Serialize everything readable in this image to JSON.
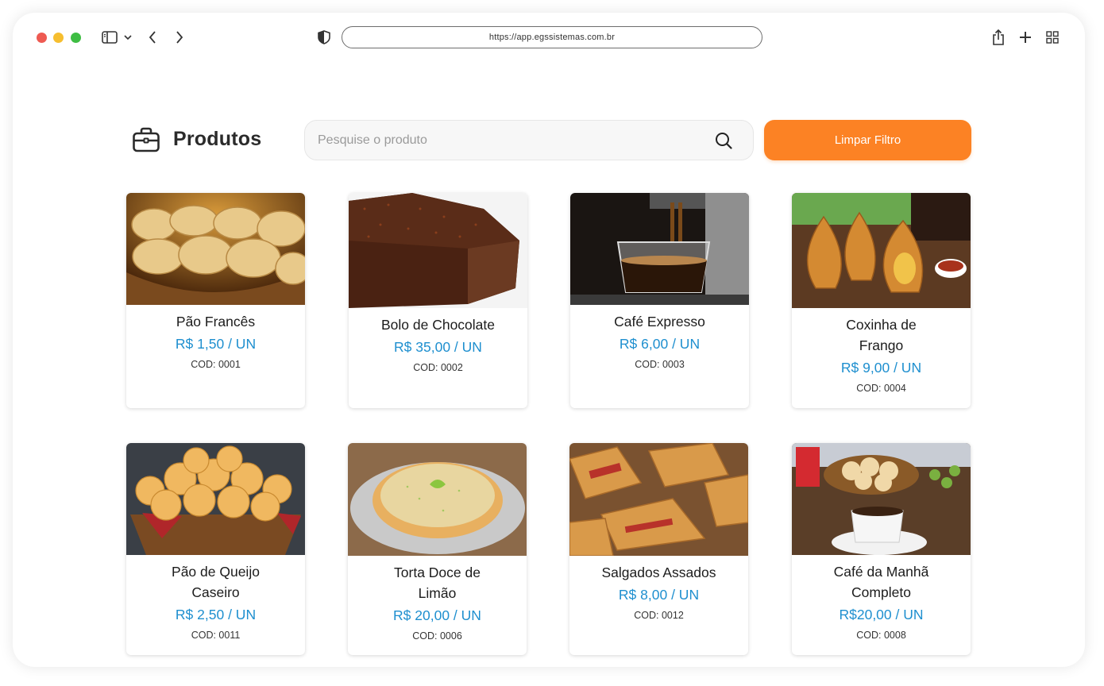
{
  "browser": {
    "url": "https://app.egssistemas.com.br",
    "icons": [
      "sidebar-icon",
      "chevron-down-icon",
      "back-icon",
      "forward-icon",
      "shield-icon",
      "share-icon",
      "plus-icon",
      "tabs-grid-icon"
    ]
  },
  "header": {
    "title": "Produtos",
    "title_icon": "briefcase-icon",
    "search_placeholder": "Pesquise o produto",
    "clear_button": "Limpar Filtro"
  },
  "colors": {
    "accent": "#fc8224",
    "price": "#1e8fcf"
  },
  "products": [
    {
      "name": "Pão Francês",
      "price": "R$ 1,50 / UN",
      "code": "COD: 0001"
    },
    {
      "name": "Bolo de Chocolate",
      "price": "R$ 35,00 / UN",
      "code": "COD: 0002"
    },
    {
      "name": "Café Expresso",
      "price": "R$ 6,00 / UN",
      "code": "COD: 0003"
    },
    {
      "name": "Coxinha de Frango",
      "price": "R$ 9,00 / UN",
      "code": "COD: 0004"
    },
    {
      "name": "Pão de Queijo Caseiro",
      "price": "R$ 2,50 / UN",
      "code": "COD: 0011"
    },
    {
      "name": "Torta Doce de Limão",
      "price": "R$ 20,00 / UN",
      "code": "COD: 0006"
    },
    {
      "name": "Salgados Assados",
      "price": "R$ 8,00 / UN",
      "code": "COD: 0012"
    },
    {
      "name": "Café da Manhã Completo",
      "price": "R$20,00 / UN",
      "code": "COD: 0008"
    }
  ]
}
